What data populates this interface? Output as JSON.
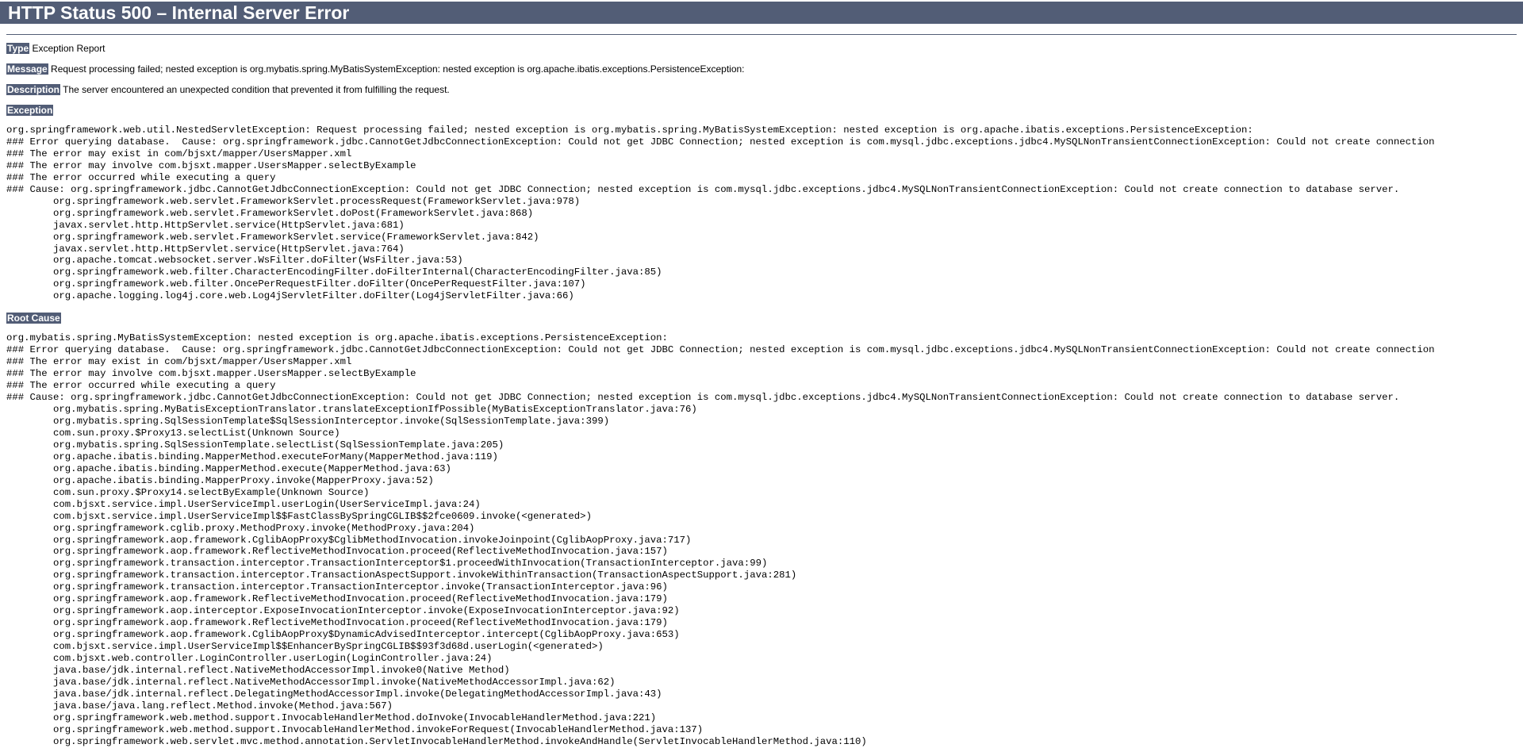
{
  "page": {
    "title": "HTTP Status 500 – Internal Server Error"
  },
  "type": {
    "label": "Type",
    "value": "Exception Report"
  },
  "message": {
    "label": "Message",
    "value": "Request processing failed; nested exception is org.mybatis.spring.MyBatisSystemException: nested exception is org.apache.ibatis.exceptions.PersistenceException:"
  },
  "description": {
    "label": "Description",
    "value": "The server encountered an unexpected condition that prevented it from fulfilling the request."
  },
  "exception": {
    "label": "Exception",
    "trace": "org.springframework.web.util.NestedServletException: Request processing failed; nested exception is org.mybatis.spring.MyBatisSystemException: nested exception is org.apache.ibatis.exceptions.PersistenceException:\n### Error querying database.  Cause: org.springframework.jdbc.CannotGetJdbcConnectionException: Could not get JDBC Connection; nested exception is com.mysql.jdbc.exceptions.jdbc4.MySQLNonTransientConnectionException: Could not create connection\n### The error may exist in com/bjsxt/mapper/UsersMapper.xml\n### The error may involve com.bjsxt.mapper.UsersMapper.selectByExample\n### The error occurred while executing a query\n### Cause: org.springframework.jdbc.CannotGetJdbcConnectionException: Could not get JDBC Connection; nested exception is com.mysql.jdbc.exceptions.jdbc4.MySQLNonTransientConnectionException: Could not create connection to database server.\n\torg.springframework.web.servlet.FrameworkServlet.processRequest(FrameworkServlet.java:978)\n\torg.springframework.web.servlet.FrameworkServlet.doPost(FrameworkServlet.java:868)\n\tjavax.servlet.http.HttpServlet.service(HttpServlet.java:681)\n\torg.springframework.web.servlet.FrameworkServlet.service(FrameworkServlet.java:842)\n\tjavax.servlet.http.HttpServlet.service(HttpServlet.java:764)\n\torg.apache.tomcat.websocket.server.WsFilter.doFilter(WsFilter.java:53)\n\torg.springframework.web.filter.CharacterEncodingFilter.doFilterInternal(CharacterEncodingFilter.java:85)\n\torg.springframework.web.filter.OncePerRequestFilter.doFilter(OncePerRequestFilter.java:107)\n\torg.apache.logging.log4j.core.web.Log4jServletFilter.doFilter(Log4jServletFilter.java:66)"
  },
  "root_cause": {
    "label": "Root Cause",
    "trace": "org.mybatis.spring.MyBatisSystemException: nested exception is org.apache.ibatis.exceptions.PersistenceException:\n### Error querying database.  Cause: org.springframework.jdbc.CannotGetJdbcConnectionException: Could not get JDBC Connection; nested exception is com.mysql.jdbc.exceptions.jdbc4.MySQLNonTransientConnectionException: Could not create connection\n### The error may exist in com/bjsxt/mapper/UsersMapper.xml\n### The error may involve com.bjsxt.mapper.UsersMapper.selectByExample\n### The error occurred while executing a query\n### Cause: org.springframework.jdbc.CannotGetJdbcConnectionException: Could not get JDBC Connection; nested exception is com.mysql.jdbc.exceptions.jdbc4.MySQLNonTransientConnectionException: Could not create connection to database server.\n\torg.mybatis.spring.MyBatisExceptionTranslator.translateExceptionIfPossible(MyBatisExceptionTranslator.java:76)\n\torg.mybatis.spring.SqlSessionTemplate$SqlSessionInterceptor.invoke(SqlSessionTemplate.java:399)\n\tcom.sun.proxy.$Proxy13.selectList(Unknown Source)\n\torg.mybatis.spring.SqlSessionTemplate.selectList(SqlSessionTemplate.java:205)\n\torg.apache.ibatis.binding.MapperMethod.executeForMany(MapperMethod.java:119)\n\torg.apache.ibatis.binding.MapperMethod.execute(MapperMethod.java:63)\n\torg.apache.ibatis.binding.MapperProxy.invoke(MapperProxy.java:52)\n\tcom.sun.proxy.$Proxy14.selectByExample(Unknown Source)\n\tcom.bjsxt.service.impl.UserServiceImpl.userLogin(UserServiceImpl.java:24)\n\tcom.bjsxt.service.impl.UserServiceImpl$$FastClassBySpringCGLIB$$2fce0609.invoke(<generated>)\n\torg.springframework.cglib.proxy.MethodProxy.invoke(MethodProxy.java:204)\n\torg.springframework.aop.framework.CglibAopProxy$CglibMethodInvocation.invokeJoinpoint(CglibAopProxy.java:717)\n\torg.springframework.aop.framework.ReflectiveMethodInvocation.proceed(ReflectiveMethodInvocation.java:157)\n\torg.springframework.transaction.interceptor.TransactionInterceptor$1.proceedWithInvocation(TransactionInterceptor.java:99)\n\torg.springframework.transaction.interceptor.TransactionAspectSupport.invokeWithinTransaction(TransactionAspectSupport.java:281)\n\torg.springframework.transaction.interceptor.TransactionInterceptor.invoke(TransactionInterceptor.java:96)\n\torg.springframework.aop.framework.ReflectiveMethodInvocation.proceed(ReflectiveMethodInvocation.java:179)\n\torg.springframework.aop.interceptor.ExposeInvocationInterceptor.invoke(ExposeInvocationInterceptor.java:92)\n\torg.springframework.aop.framework.ReflectiveMethodInvocation.proceed(ReflectiveMethodInvocation.java:179)\n\torg.springframework.aop.framework.CglibAopProxy$DynamicAdvisedInterceptor.intercept(CglibAopProxy.java:653)\n\tcom.bjsxt.service.impl.UserServiceImpl$$EnhancerBySpringCGLIB$$93f3d68d.userLogin(<generated>)\n\tcom.bjsxt.web.controller.LoginController.userLogin(LoginController.java:24)\n\tjava.base/jdk.internal.reflect.NativeMethodAccessorImpl.invoke0(Native Method)\n\tjava.base/jdk.internal.reflect.NativeMethodAccessorImpl.invoke(NativeMethodAccessorImpl.java:62)\n\tjava.base/jdk.internal.reflect.DelegatingMethodAccessorImpl.invoke(DelegatingMethodAccessorImpl.java:43)\n\tjava.base/java.lang.reflect.Method.invoke(Method.java:567)\n\torg.springframework.web.method.support.InvocableHandlerMethod.doInvoke(InvocableHandlerMethod.java:221)\n\torg.springframework.web.method.support.InvocableHandlerMethod.invokeForRequest(InvocableHandlerMethod.java:137)\n\torg.springframework.web.servlet.mvc.method.annotation.ServletInvocableHandlerMethod.invokeAndHandle(ServletInvocableHandlerMethod.java:110)"
  },
  "colors": {
    "header_bg": "#525d76",
    "header_text": "#ffffff",
    "text": "#000000",
    "background": "#ffffff"
  }
}
